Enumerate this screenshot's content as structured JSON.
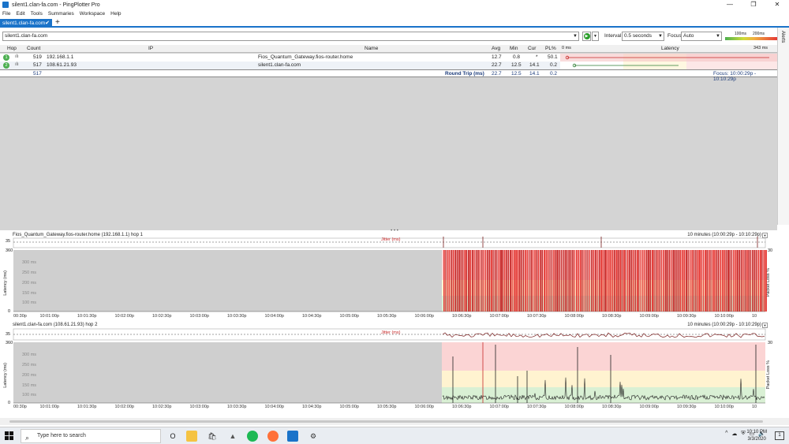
{
  "window": {
    "title": "silent1.clan-fa.com - PingPlotter Pro"
  },
  "menu": [
    "File",
    "Edit",
    "Tools",
    "Summaries",
    "Workspace",
    "Help"
  ],
  "tab": {
    "label": "silent1.clan-fa.com"
  },
  "toolbar": {
    "target": "silent1.clan-fa.com",
    "interval_label": "Interval",
    "interval_value": "0.5 seconds",
    "focus_label": "Focus",
    "focus_value": "Auto",
    "scale_100": "100ms",
    "scale_200": "200ms"
  },
  "alerts_label": "Alerts",
  "grid": {
    "headers": {
      "hop": "Hop",
      "count": "Count",
      "ip": "IP",
      "name": "Name",
      "avg": "Avg",
      "min": "Min",
      "cur": "Cur",
      "pl": "PL%",
      "latency_min": "0 ms",
      "latency": "Latency",
      "latency_max": "343 ms"
    },
    "rows": [
      {
        "hop": "1",
        "count": "519",
        "ip": "192.168.1.1",
        "name": "Fios_Quantum_Gateway.fios-router.home",
        "avg": "12.7",
        "min": "0.8",
        "cur": "*",
        "pl": "50.1"
      },
      {
        "hop": "2",
        "count": "517",
        "ip": "108.61.21.93",
        "name": "silent1.clan-fa.com",
        "avg": "22.7",
        "min": "12.5",
        "cur": "14.1",
        "pl": "0.2"
      }
    ],
    "round_trip": {
      "count": "517",
      "label": "Round Trip (ms)",
      "avg": "22.7",
      "min": "12.5",
      "cur": "14.1",
      "pl": "0.2",
      "focus": "Focus: 10:00:29p - 10:10:29p"
    }
  },
  "graph1": {
    "title": "Fios_Quantum_Gateway.fios-router.home (192.168.1.1) hop 1",
    "range": "10 minutes (10:00:29p - 10:10:29p)",
    "jitter_label": "Jitter (ms)",
    "jitter_max": "35",
    "y_max": "360",
    "y_min": "0",
    "y_ticks": [
      "300 ms",
      "250 ms",
      "200 ms",
      "150 ms",
      "100 ms",
      "50 ms"
    ],
    "latency_label": "Latency (ms)",
    "pl_label": "Packet Loss %",
    "pl_max": "30"
  },
  "graph2": {
    "title": "silent1.clan-fa.com (108.61.21.93) hop 2",
    "range": "10 minutes (10:00:29p - 10:10:29p)",
    "jitter_label": "Jitter (ms)",
    "jitter_max": "35",
    "y_max": "360",
    "y_min": "0",
    "y_ticks": [
      "300 ms",
      "250 ms",
      "200 ms",
      "150 ms",
      "100 ms",
      "50 ms"
    ],
    "latency_label": "Latency (ms)",
    "pl_label": "Packet Loss %",
    "pl_max": "30"
  },
  "x_ticks": [
    "00:30p",
    "10:01:00p",
    "10:01:30p",
    "10:02:00p",
    "10:02:30p",
    "10:03:00p",
    "10:03:30p",
    "10:04:00p",
    "10:04:30p",
    "10:05:00p",
    "10:05:30p",
    "10:06:00p",
    "10:06:30p",
    "10:07:00p",
    "10:07:30p",
    "10:08:00p",
    "10:08:30p",
    "10:09:00p",
    "10:09:30p",
    "10:10:00p",
    "10"
  ],
  "taskbar": {
    "search_placeholder": "Type here to search",
    "time": "10:10 PM",
    "date": "3/3/2020",
    "cortana_glyph": "O",
    "notif_glyph": "1"
  }
}
